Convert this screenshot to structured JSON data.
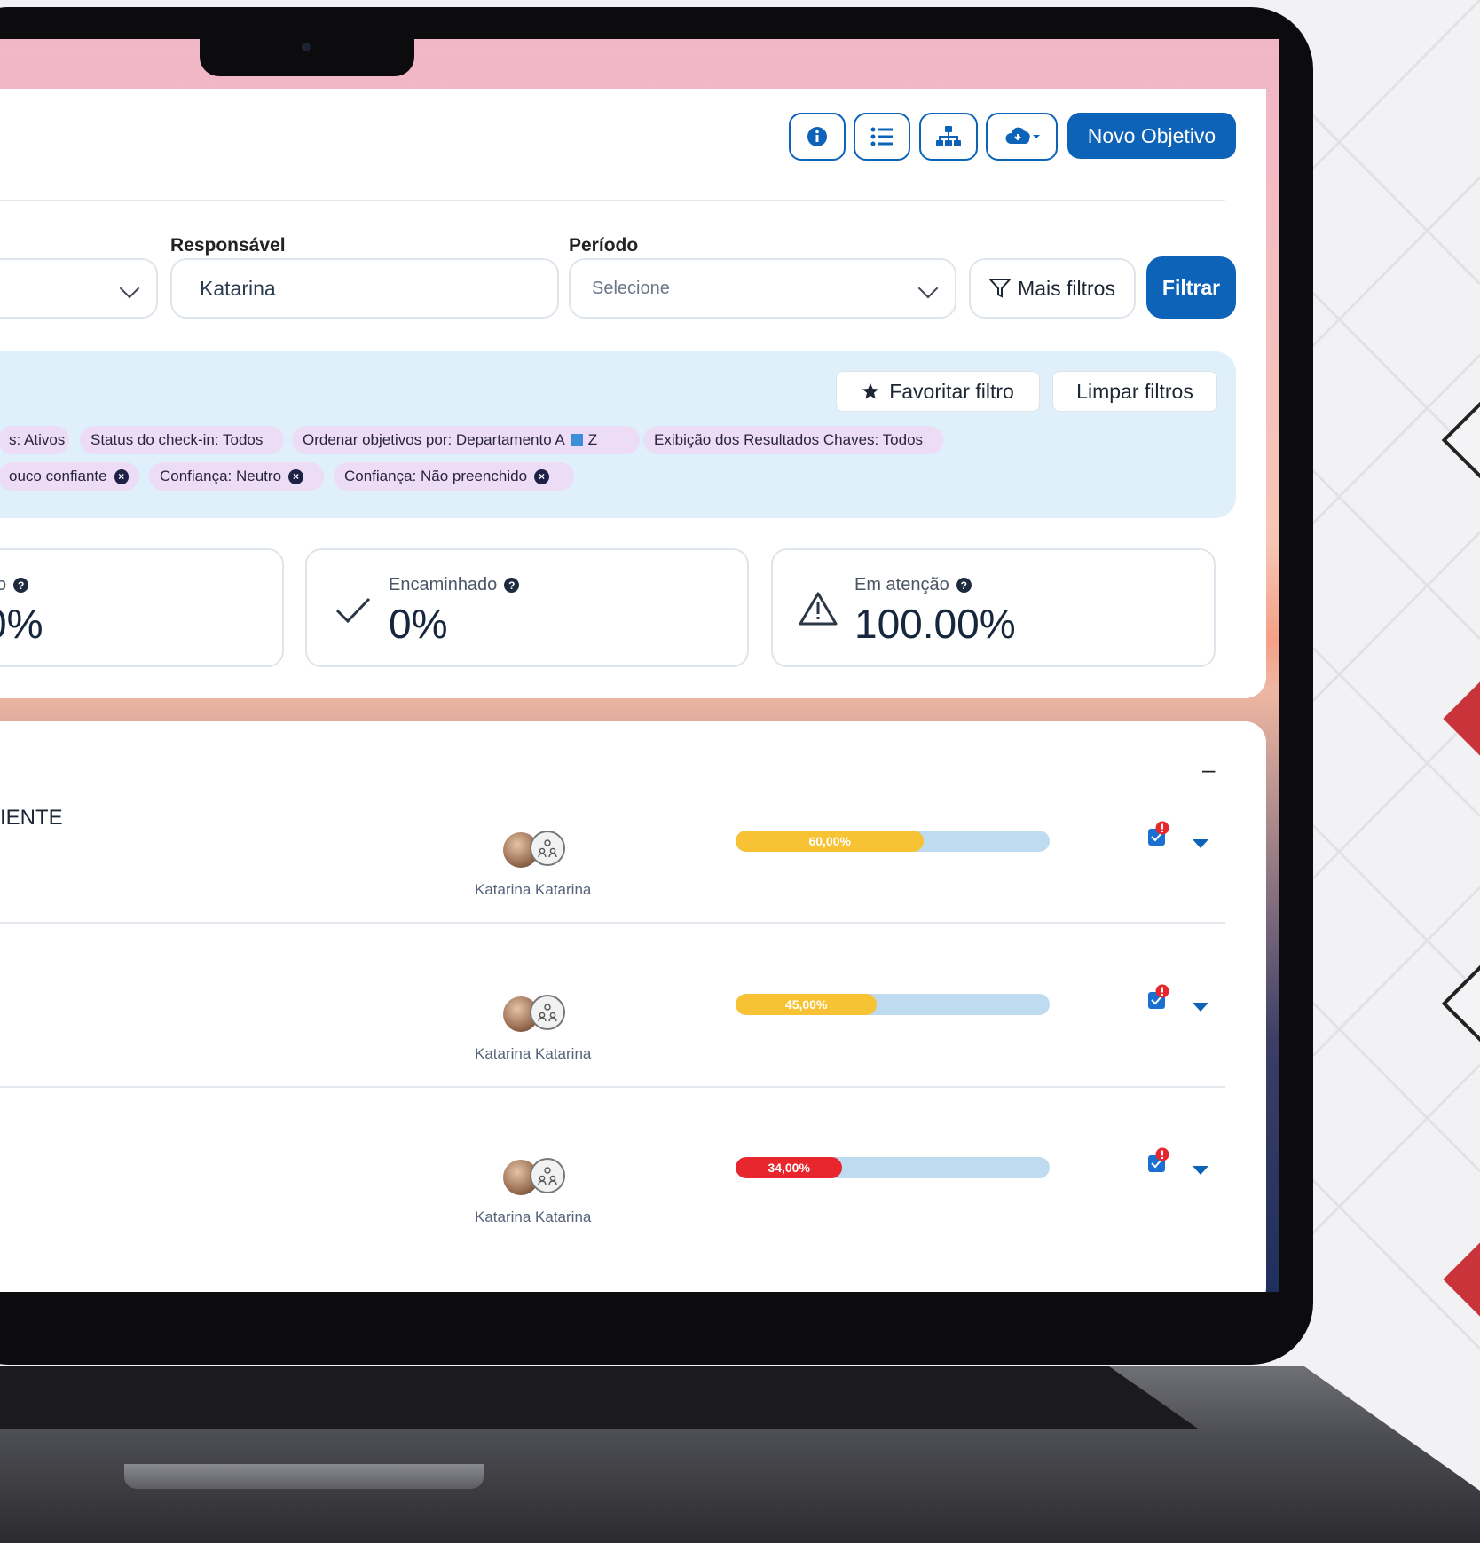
{
  "header": {
    "buttons": [
      {
        "icon": "info-icon"
      },
      {
        "icon": "list-icon"
      },
      {
        "icon": "hierarchy-icon"
      },
      {
        "icon": "cloud-download-icon"
      }
    ],
    "new_objective_label": "Novo Objetivo"
  },
  "filters": {
    "responsavel_label": "Responsável",
    "responsavel_value": "Katarina",
    "periodo_label": "Período",
    "periodo_placeholder": "Selecione",
    "more_filters_label": "Mais filtros",
    "apply_label": "Filtrar"
  },
  "active_filters": {
    "favorite_label": "Favoritar filtro",
    "clear_label": "Limpar filtros",
    "chips_row1": [
      "s: Ativos",
      "Status do check-in: Todos",
      "Ordenar objetivos por: Departamento A",
      "Exibição dos Resultados Chaves: Todos"
    ],
    "sort_suffix": "Z",
    "chips_row2": [
      "ouco confiante",
      "Confiança: Neutro",
      "Confiança: Não preenchido"
    ]
  },
  "summary": {
    "card1": {
      "label": "o",
      "value": "0%"
    },
    "card2": {
      "label": "Encaminhado",
      "value": "0%"
    },
    "card3": {
      "label": "Em atenção",
      "value": "100.00%"
    }
  },
  "objectives": {
    "collapse_label": "–",
    "rows": [
      {
        "title": "IENTE",
        "owner": "Katarina Katarina",
        "progress_label": "60,00%",
        "progress": 60,
        "color": "#f7c234"
      },
      {
        "title": "",
        "owner": "Katarina Katarina",
        "progress_label": "45,00%",
        "progress": 45,
        "color": "#f7c234"
      },
      {
        "title": "",
        "owner": "Katarina Katarina",
        "progress_label": "34,00%",
        "progress": 34,
        "color": "#e8262d"
      }
    ]
  },
  "colors": {
    "primary": "#0d63b8",
    "warning": "#f7c234",
    "danger": "#e8262d",
    "chip": "#ecdcf6",
    "filter_panel": "#dff0fb"
  }
}
